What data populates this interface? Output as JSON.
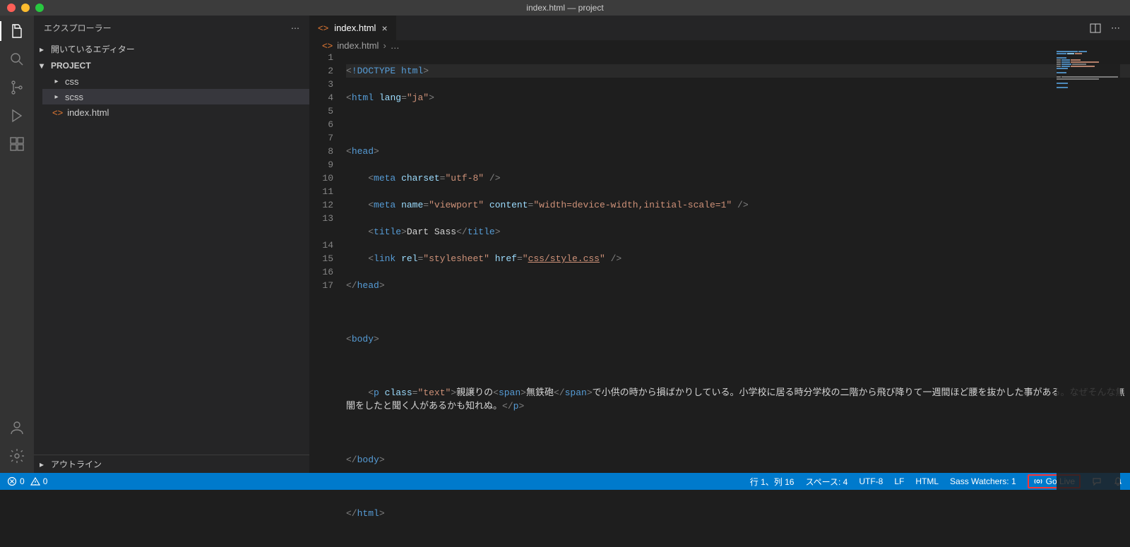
{
  "window": {
    "title": "index.html — project"
  },
  "sidebar": {
    "title": "エクスプローラー",
    "open_editors": "開いているエディター",
    "project": "PROJECT",
    "folders": [
      {
        "name": "css"
      },
      {
        "name": "scss"
      }
    ],
    "file": "index.html",
    "outline": "アウトライン"
  },
  "tab": {
    "name": "index.html"
  },
  "breadcrumb": {
    "file": "index.html",
    "more": "…"
  },
  "code": {
    "lines": {
      "l1": {
        "doc": "!DOCTYPE",
        "html": "html"
      },
      "l2": {
        "tag": "html",
        "attr": "lang",
        "val": "\"ja\""
      },
      "l4": {
        "tag": "head"
      },
      "l5": {
        "tag": "meta",
        "attr": "charset",
        "val": "\"utf-8\""
      },
      "l6": {
        "tag": "meta",
        "a1": "name",
        "v1": "\"viewport\"",
        "a2": "content",
        "v2": "\"width=device-width,initial-scale=1\""
      },
      "l7": {
        "tag": "title",
        "text": "Dart Sass"
      },
      "l8": {
        "tag": "link",
        "a1": "rel",
        "v1": "\"stylesheet\"",
        "a2": "href",
        "v2": "css/style.css"
      },
      "l9": {
        "tag": "head"
      },
      "l11": {
        "tag": "body"
      },
      "l13": {
        "tag": "p",
        "attr": "class",
        "val": "\"text\"",
        "pre": "親譲りの",
        "span": "span",
        "mid": "無鉄砲",
        "tail": "で小供の時から損ばかりしている。小学校に居る時分学校の二階から飛び降りて一週間ほど腰を抜かした事がある。なぜそんな無闇をしたと聞く人があるかも知れぬ。"
      },
      "l15": {
        "tag": "body"
      },
      "l17": {
        "tag": "html"
      }
    }
  },
  "status": {
    "errors": "0",
    "warnings": "0",
    "cursor": "行 1、列 16",
    "spaces": "スペース: 4",
    "encoding": "UTF-8",
    "eol": "LF",
    "lang": "HTML",
    "sass": "Sass Watchers: 1",
    "golive": "Go Live"
  }
}
